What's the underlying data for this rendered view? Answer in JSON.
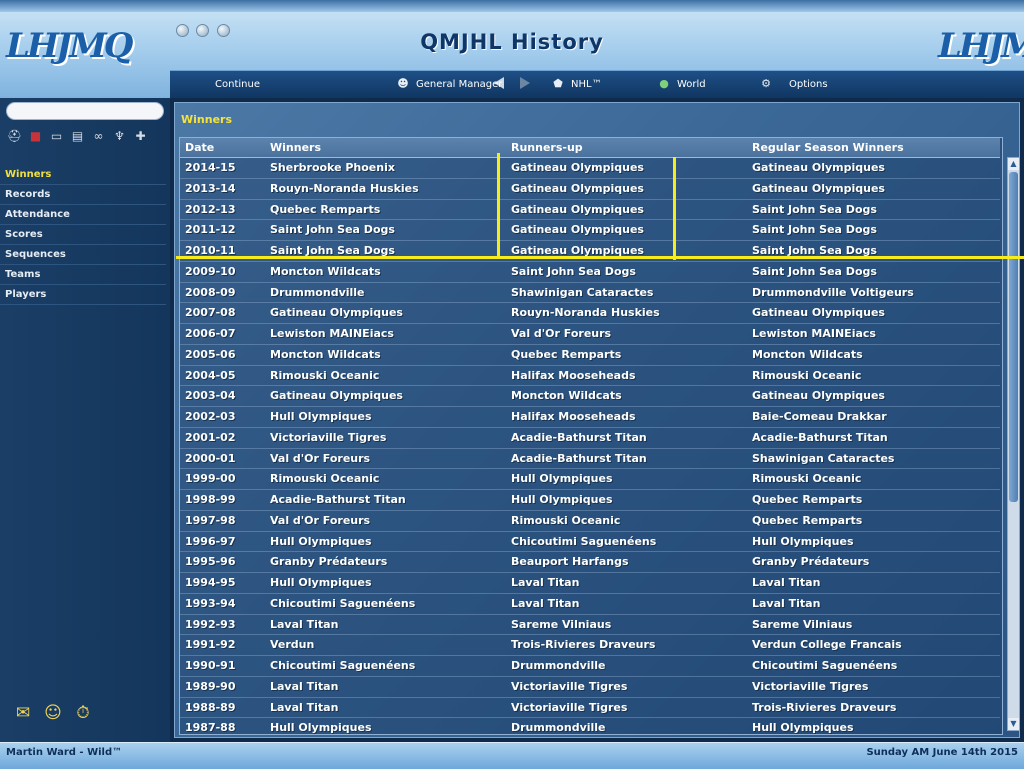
{
  "header": {
    "title": "QMJHL History",
    "logo_text": "LHJMQ"
  },
  "menubar": {
    "items": [
      {
        "label": "Continue",
        "icon": ""
      },
      {
        "label": "General Manager",
        "icon": "manager-icon"
      },
      {
        "label": "NHL™",
        "icon": "nhl-logo-icon"
      },
      {
        "label": "World",
        "icon": "globe-icon"
      },
      {
        "label": "Options",
        "icon": "gear-icon"
      }
    ]
  },
  "sidebar": {
    "items": [
      {
        "label": "Winners",
        "active": true
      },
      {
        "label": "Records"
      },
      {
        "label": "Attendance"
      },
      {
        "label": "Scores"
      },
      {
        "label": "Sequences"
      },
      {
        "label": "Teams"
      },
      {
        "label": "Players"
      }
    ]
  },
  "panel": {
    "title": "Winners",
    "columns": [
      "Date",
      "Winners",
      "Runners-up",
      "Regular Season Winners"
    ],
    "rows": [
      [
        "2014-15",
        "Sherbrooke Phoenix",
        "Gatineau Olympiques",
        "Gatineau Olympiques"
      ],
      [
        "2013-14",
        "Rouyn-Noranda Huskies",
        "Gatineau Olympiques",
        "Gatineau Olympiques"
      ],
      [
        "2012-13",
        "Quebec Remparts",
        "Gatineau Olympiques",
        "Saint John Sea Dogs"
      ],
      [
        "2011-12",
        "Saint John Sea Dogs",
        "Gatineau Olympiques",
        "Saint John Sea Dogs"
      ],
      [
        "2010-11",
        "Saint John Sea Dogs",
        "Gatineau Olympiques",
        "Saint John Sea Dogs"
      ],
      [
        "2009-10",
        "Moncton Wildcats",
        "Saint John Sea Dogs",
        "Saint John Sea Dogs"
      ],
      [
        "2008-09",
        "Drummondville",
        "Shawinigan Cataractes",
        "Drummondville Voltigeurs"
      ],
      [
        "2007-08",
        "Gatineau Olympiques",
        "Rouyn-Noranda Huskies",
        "Gatineau Olympiques"
      ],
      [
        "2006-07",
        "Lewiston MAINEiacs",
        "Val d'Or Foreurs",
        "Lewiston MAINEiacs"
      ],
      [
        "2005-06",
        "Moncton Wildcats",
        "Quebec Remparts",
        "Moncton Wildcats"
      ],
      [
        "2004-05",
        "Rimouski Oceanic",
        "Halifax Mooseheads",
        "Rimouski Oceanic"
      ],
      [
        "2003-04",
        "Gatineau Olympiques",
        "Moncton Wildcats",
        "Gatineau Olympiques"
      ],
      [
        "2002-03",
        "Hull Olympiques",
        "Halifax Mooseheads",
        "Baie-Comeau Drakkar"
      ],
      [
        "2001-02",
        "Victoriaville Tigres",
        "Acadie-Bathurst Titan",
        "Acadie-Bathurst Titan"
      ],
      [
        "2000-01",
        "Val d'Or Foreurs",
        "Acadie-Bathurst Titan",
        "Shawinigan Cataractes"
      ],
      [
        "1999-00",
        "Rimouski Oceanic",
        "Hull Olympiques",
        "Rimouski Oceanic"
      ],
      [
        "1998-99",
        "Acadie-Bathurst Titan",
        "Hull Olympiques",
        "Quebec Remparts"
      ],
      [
        "1997-98",
        "Val d'Or Foreurs",
        "Rimouski Oceanic",
        "Quebec Remparts"
      ],
      [
        "1996-97",
        "Hull Olympiques",
        "Chicoutimi Saguenéens",
        "Hull Olympiques"
      ],
      [
        "1995-96",
        "Granby Prédateurs",
        "Beauport Harfangs",
        "Granby Prédateurs"
      ],
      [
        "1994-95",
        "Hull Olympiques",
        "Laval Titan",
        "Laval Titan"
      ],
      [
        "1993-94",
        "Chicoutimi Saguenéens",
        "Laval Titan",
        "Laval Titan"
      ],
      [
        "1992-93",
        "Laval Titan",
        "Sareme Vilniaus",
        "Sareme Vilniaus"
      ],
      [
        "1991-92",
        "Verdun",
        "Trois-Rivieres Draveurs",
        "Verdun College Francais"
      ],
      [
        "1990-91",
        "Chicoutimi Saguenéens",
        "Drummondville",
        "Chicoutimi Saguenéens"
      ],
      [
        "1989-90",
        "Laval Titan",
        "Victoriaville Tigres",
        "Victoriaville Tigres"
      ],
      [
        "1988-89",
        "Laval Titan",
        "Victoriaville Tigres",
        "Trois-Rivieres Draveurs"
      ],
      [
        "1987-88",
        "Hull Olympiques",
        "Drummondville",
        "Hull Olympiques"
      ]
    ]
  },
  "status": {
    "user": "Martin Ward - Wild™",
    "date": "Sunday AM June 14th 2015"
  },
  "colors": {
    "accent_yellow": "#f2e040",
    "header_blue": "#0f3668",
    "markup_yellow": "#f7ec1a"
  }
}
